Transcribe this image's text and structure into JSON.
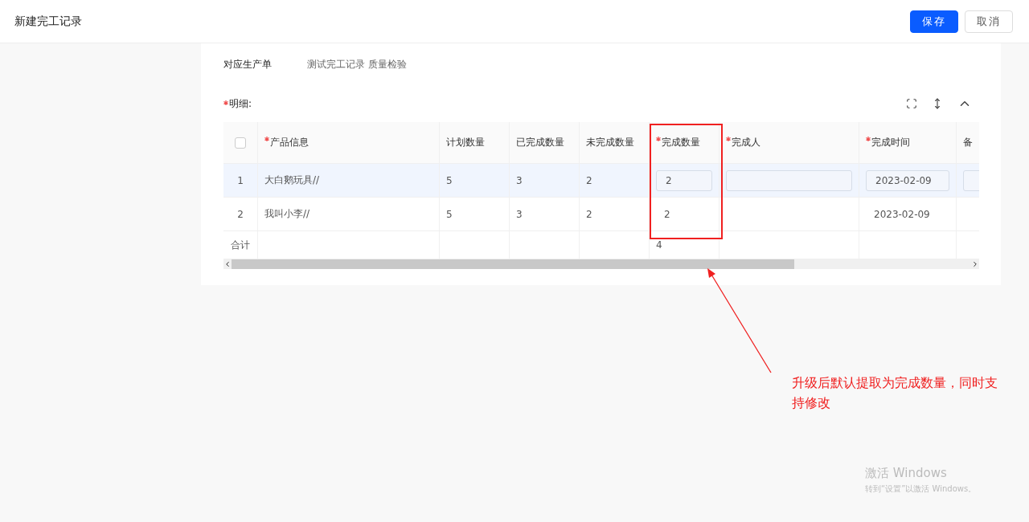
{
  "header": {
    "title": "新建完工记录",
    "buttons": [
      {
        "label": "保存",
        "kind": "primary"
      },
      {
        "label": "取消",
        "kind": "default"
      }
    ]
  },
  "form": {
    "field_label": "对应生产单",
    "field_value": "测试完工记录 质量检验",
    "detail_label": "明细:",
    "detail_required": true
  },
  "table": {
    "select_all_checked": false,
    "columns": [
      {
        "label": "产品信息",
        "required": true
      },
      {
        "label": "计划数量",
        "required": false
      },
      {
        "label": "已完成数量",
        "required": false
      },
      {
        "label": "未完成数量",
        "required": false
      },
      {
        "label": "完成数量",
        "required": true
      },
      {
        "label": "完成人",
        "required": true
      },
      {
        "label": "完成时间",
        "required": true
      },
      {
        "label": "备",
        "required": false
      }
    ],
    "rows": [
      {
        "index": "1",
        "selected": true,
        "cells": [
          {
            "kind": "text",
            "text": "大白鹅玩具//"
          },
          {
            "kind": "text",
            "text": "5"
          },
          {
            "kind": "text",
            "text": "3"
          },
          {
            "kind": "text",
            "text": "2"
          },
          {
            "kind": "input",
            "text": "2"
          },
          {
            "kind": "input"
          },
          {
            "kind": "input",
            "text": "2023-02-09"
          },
          {
            "kind": "input"
          }
        ]
      },
      {
        "index": "2",
        "selected": false,
        "cells": [
          {
            "kind": "text",
            "text": "我叫小李//"
          },
          {
            "kind": "text",
            "text": "5"
          },
          {
            "kind": "text",
            "text": "3"
          },
          {
            "kind": "text",
            "text": "2"
          },
          {
            "kind": "text",
            "text": "2"
          },
          {
            "kind": "text"
          },
          {
            "kind": "text",
            "text": "2023-02-09"
          },
          {
            "kind": "text"
          }
        ]
      }
    ],
    "total": {
      "label": "合计",
      "cells": [
        null,
        null,
        null,
        null,
        "4",
        null,
        null,
        null
      ]
    }
  },
  "annotation": {
    "text": "升级后默认提取为完成数量，同时支持修改"
  },
  "os_notice": {
    "title": "激活 Windows",
    "text": "转到“设置”以激活 Windows。"
  }
}
